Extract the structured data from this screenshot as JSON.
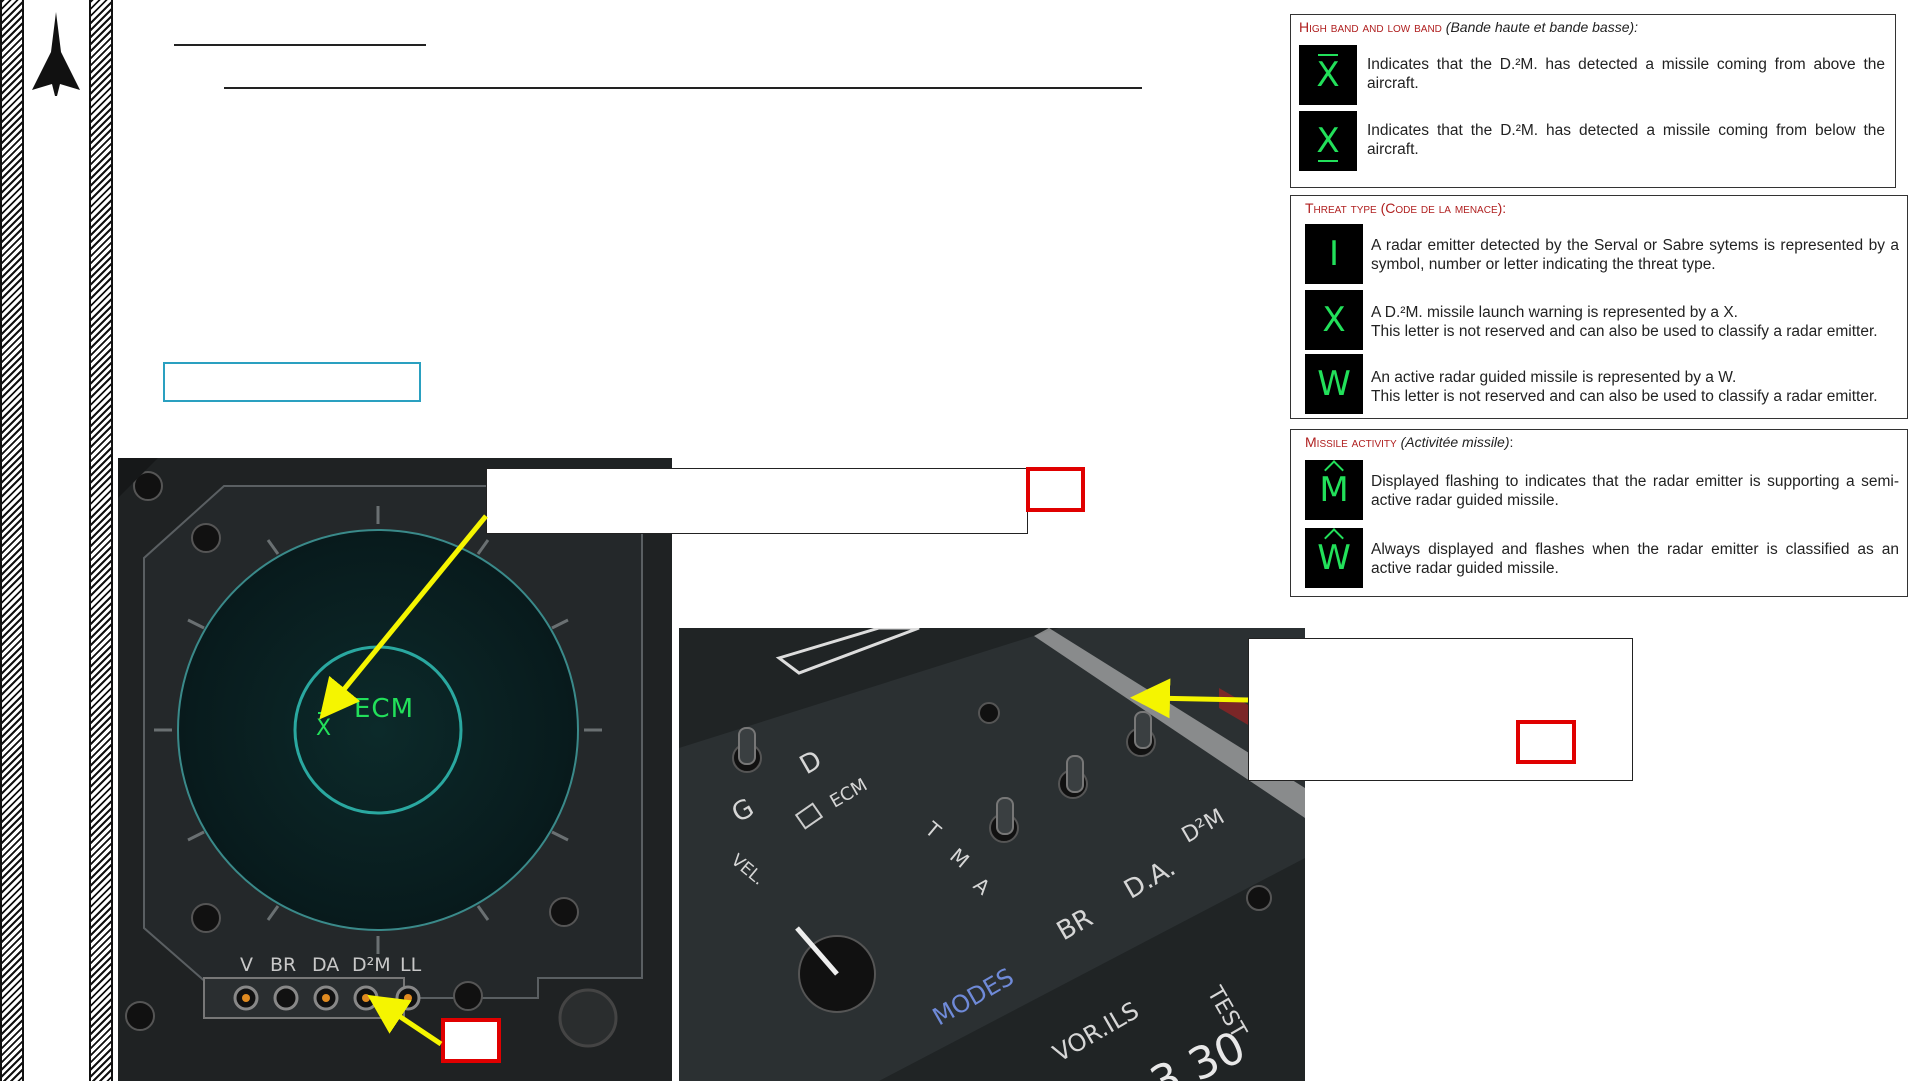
{
  "panels": {
    "band": {
      "title": "High band and low band",
      "title_fr": "(Bande haute et bande basse):",
      "items": [
        {
          "symbol": "X",
          "mark": "overbar",
          "text": "Indicates that the D.²M. has detected a missile coming from above the aircraft."
        },
        {
          "symbol": "X",
          "mark": "underbar",
          "text": "Indicates that the D.²M. has detected a missile coming from below the aircraft."
        }
      ]
    },
    "threat": {
      "title": "Threat type (Code de la menace):",
      "items": [
        {
          "symbol": "I",
          "text": "A radar emitter detected by the Serval or Sabre sytems is represented by a symbol, number or letter indicating the threat type."
        },
        {
          "symbol": "X",
          "text": "A D.²M. missile launch warning is represented by a X.\nThis letter is not reserved and can also be used to classify a radar emitter."
        },
        {
          "symbol": "W",
          "text": "An active radar guided missile is represented by a W.\nThis letter is not reserved and can also be used to classify a radar emitter."
        }
      ]
    },
    "activity": {
      "title": "Missile activity",
      "title_fr": "(Activitée missile)",
      "title_end": ":",
      "items": [
        {
          "symbol": "M",
          "mark": "hat",
          "text": "Displayed flashing to indicates that the radar emitter is supporting a semi-active radar guided missile."
        },
        {
          "symbol": "W",
          "mark": "hat",
          "text": "Always displayed and flashes when the radar emitter is classified as an active radar guided missile."
        }
      ]
    }
  },
  "rwr_display": {
    "scope_symbols": {
      "band_symbol": "X",
      "text": "ECM"
    },
    "indicator_labels": [
      "V",
      "BR",
      "DA",
      "D²M",
      "LL"
    ]
  },
  "control_panel": {
    "labels": {
      "g": "G",
      "d": "D",
      "ecm": "ECM",
      "vel": "VEL.",
      "t": "T",
      "m": "M",
      "a": "A",
      "br": "BR",
      "da": "D.A.",
      "d2m": "D²M",
      "modes": "MODES",
      "vor_ils": "VOR.ILS",
      "test": "TEST",
      "freq": "3 30"
    }
  },
  "colors": {
    "symbol_green": "#22e05a",
    "title_red": "#b02020",
    "arrow_yellow": "#f5f500",
    "callout_red": "#e00000",
    "scope_teal": "#2aa8a0"
  }
}
